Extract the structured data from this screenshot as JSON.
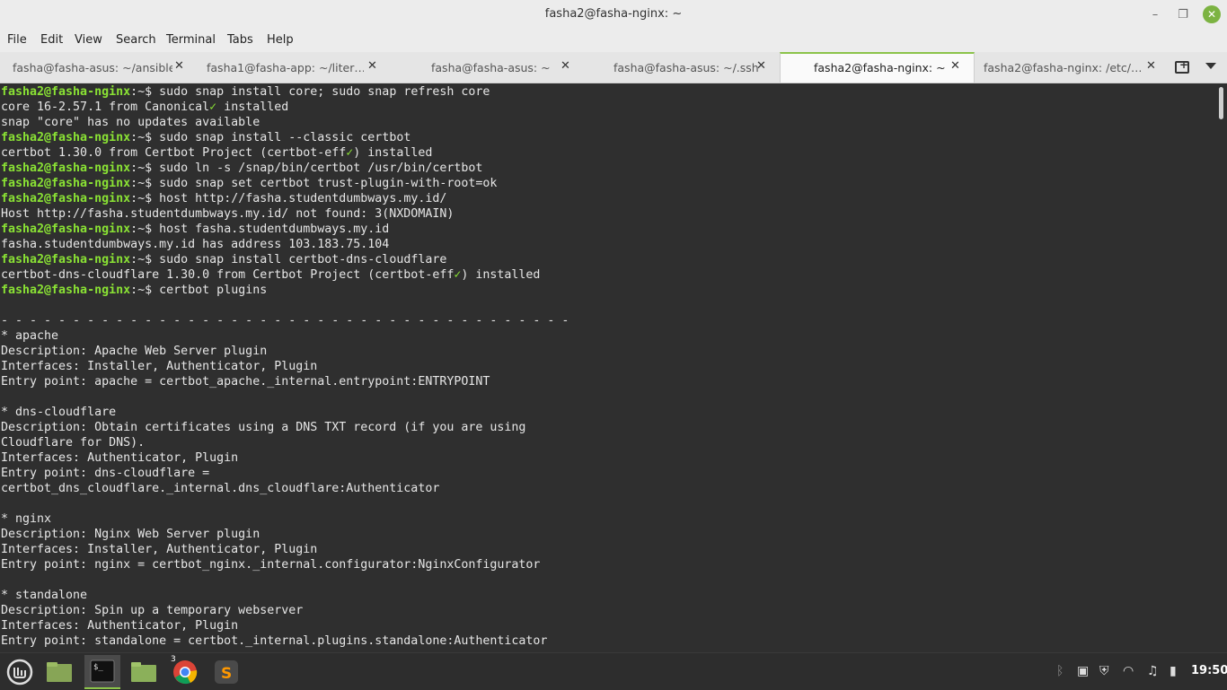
{
  "window": {
    "title": "fasha2@fasha-nginx: ~",
    "buttons": [
      "–",
      "❐",
      "✕"
    ]
  },
  "menu": [
    "File",
    "Edit",
    "View",
    "Search",
    "Terminal",
    "Tabs",
    "Help"
  ],
  "tabs": [
    {
      "label": "fasha@fasha-asus: ~/ansible",
      "active": false
    },
    {
      "label": "fasha1@fasha-app: ~/liter…",
      "active": false
    },
    {
      "label": "fasha@fasha-asus: ~",
      "active": false
    },
    {
      "label": "fasha@fasha-asus: ~/.ssh",
      "active": false
    },
    {
      "label": "fasha2@fasha-nginx: ~",
      "active": true
    },
    {
      "label": "fasha2@fasha-nginx: /etc/…",
      "active": false
    }
  ],
  "prompt": {
    "user_host": "fasha2@fasha-nginx",
    "path_sep": ":~$ "
  },
  "terminal": {
    "lines": [
      {
        "type": "cmd",
        "text": "sudo snap install core; sudo snap refresh core"
      },
      {
        "type": "out",
        "text": "core 16-2.57.1 from Canonical",
        "check": "✓",
        "after": " installed"
      },
      {
        "type": "out",
        "text": "snap \"core\" has no updates available"
      },
      {
        "type": "cmd",
        "text": "sudo snap install --classic certbot"
      },
      {
        "type": "out",
        "text": "certbot 1.30.0 from Certbot Project (certbot-eff",
        "check": "✓",
        "after": ") installed"
      },
      {
        "type": "cmd",
        "text": "sudo ln -s /snap/bin/certbot /usr/bin/certbot"
      },
      {
        "type": "cmd",
        "text": "sudo snap set certbot trust-plugin-with-root=ok"
      },
      {
        "type": "cmd",
        "text": "host http://fasha.studentdumbways.my.id/"
      },
      {
        "type": "out",
        "text": "Host http://fasha.studentdumbways.my.id/ not found: 3(NXDOMAIN)"
      },
      {
        "type": "cmd",
        "text": "host fasha.studentdumbways.my.id"
      },
      {
        "type": "out",
        "text": "fasha.studentdumbways.my.id has address 103.183.75.104"
      },
      {
        "type": "cmd",
        "text": "sudo snap install certbot-dns-cloudflare"
      },
      {
        "type": "out",
        "text": "certbot-dns-cloudflare 1.30.0 from Certbot Project (certbot-eff",
        "check": "✓",
        "after": ") installed"
      },
      {
        "type": "cmd",
        "text": "certbot plugins"
      },
      {
        "type": "out",
        "text": ""
      },
      {
        "type": "out",
        "text": "- - - - - - - - - - - - - - - - - - - - - - - - - - - - - - - - - - - - - - - -"
      },
      {
        "type": "out",
        "text": "* apache"
      },
      {
        "type": "out",
        "text": "Description: Apache Web Server plugin"
      },
      {
        "type": "out",
        "text": "Interfaces: Installer, Authenticator, Plugin"
      },
      {
        "type": "out",
        "text": "Entry point: apache = certbot_apache._internal.entrypoint:ENTRYPOINT"
      },
      {
        "type": "out",
        "text": ""
      },
      {
        "type": "out",
        "text": "* dns-cloudflare"
      },
      {
        "type": "out",
        "text": "Description: Obtain certificates using a DNS TXT record (if you are using"
      },
      {
        "type": "out",
        "text": "Cloudflare for DNS)."
      },
      {
        "type": "out",
        "text": "Interfaces: Authenticator, Plugin"
      },
      {
        "type": "out",
        "text": "Entry point: dns-cloudflare ="
      },
      {
        "type": "out",
        "text": "certbot_dns_cloudflare._internal.dns_cloudflare:Authenticator"
      },
      {
        "type": "out",
        "text": ""
      },
      {
        "type": "out",
        "text": "* nginx"
      },
      {
        "type": "out",
        "text": "Description: Nginx Web Server plugin"
      },
      {
        "type": "out",
        "text": "Interfaces: Installer, Authenticator, Plugin"
      },
      {
        "type": "out",
        "text": "Entry point: nginx = certbot_nginx._internal.configurator:NginxConfigurator"
      },
      {
        "type": "out",
        "text": ""
      },
      {
        "type": "out",
        "text": "* standalone"
      },
      {
        "type": "out",
        "text": "Description: Spin up a temporary webserver"
      },
      {
        "type": "out",
        "text": "Interfaces: Authenticator, Plugin"
      },
      {
        "type": "out",
        "text": "Entry point: standalone = certbot._internal.plugins.standalone:Authenticator"
      }
    ]
  },
  "taskbar": {
    "apps": [
      {
        "name": "mint-menu-icon",
        "active": false
      },
      {
        "name": "show-desktop-icon",
        "active": false
      },
      {
        "name": "terminal-icon",
        "active": true
      },
      {
        "name": "files-icon",
        "active": false
      },
      {
        "name": "chrome-icon",
        "active": false,
        "badge": "3"
      },
      {
        "name": "sublime-text-icon",
        "active": false
      }
    ],
    "tray": [
      "bluetooth-icon",
      "clipboard-icon",
      "shield-icon",
      "wifi-icon",
      "volume-icon",
      "battery-icon"
    ],
    "clock": "19:50"
  }
}
